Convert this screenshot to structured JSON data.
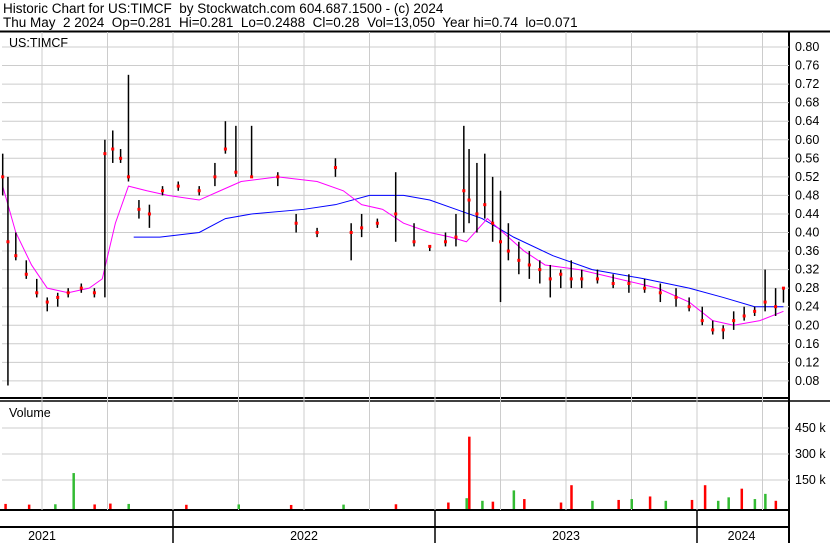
{
  "header": {
    "line1": "Historic Chart for US:TIMCF  by Stockwatch.com 604.687.1500 - (c) 2024",
    "line2": "Thu May  2 2024  Op=0.281  Hi=0.281  Lo=0.2488  Cl=0.28  Vol=13,050  Year hi=0.74  lo=0.071"
  },
  "chart_data": {
    "type": "line",
    "symbol": "US:TIMCF",
    "volume_label": "Volume",
    "price_ticks": [
      "0.80",
      "0.76",
      "0.72",
      "0.68",
      "0.64",
      "0.60",
      "0.56",
      "0.52",
      "0.48",
      "0.44",
      "0.40",
      "0.36",
      "0.32",
      "0.28",
      "0.24",
      "0.20",
      "0.16",
      "0.12",
      "0.08"
    ],
    "volume_ticks": [
      {
        "v": 450000,
        "label": "450 k"
      },
      {
        "v": 300000,
        "label": "300 k"
      },
      {
        "v": 150000,
        "label": "150 k"
      }
    ],
    "years": [
      {
        "label": "2021",
        "t": 2021.5
      },
      {
        "label": "2022",
        "t": 2022.5
      },
      {
        "label": "2023",
        "t": 2023.5
      },
      {
        "label": "2024",
        "t": 2024.17
      }
    ],
    "colors": {
      "price": "#000000",
      "close": "#ff0000",
      "ma_short": "#ff00ff",
      "ma_long": "#0000ff",
      "vol_up": "#33bb33",
      "vol_down": "#ff0000"
    },
    "ohlc": [
      [
        2021.35,
        0.57,
        0.48,
        0.52
      ],
      [
        2021.37,
        0.52,
        0.07,
        0.38
      ],
      [
        2021.4,
        0.4,
        0.34,
        0.35
      ],
      [
        2021.44,
        0.34,
        0.3,
        0.31
      ],
      [
        2021.48,
        0.3,
        0.26,
        0.27
      ],
      [
        2021.52,
        0.26,
        0.23,
        0.25
      ],
      [
        2021.56,
        0.27,
        0.24,
        0.26
      ],
      [
        2021.6,
        0.28,
        0.26,
        0.27
      ],
      [
        2021.65,
        0.29,
        0.27,
        0.28
      ],
      [
        2021.7,
        0.28,
        0.26,
        0.27
      ],
      [
        2021.74,
        0.6,
        0.26,
        0.57
      ],
      [
        2021.77,
        0.62,
        0.55,
        0.58
      ],
      [
        2021.8,
        0.58,
        0.55,
        0.56
      ],
      [
        2021.83,
        0.74,
        0.51,
        0.52
      ],
      [
        2021.87,
        0.47,
        0.43,
        0.45
      ],
      [
        2021.91,
        0.46,
        0.41,
        0.44
      ],
      [
        2021.96,
        0.5,
        0.48,
        0.49
      ],
      [
        2022.02,
        0.51,
        0.49,
        0.5
      ],
      [
        2022.1,
        0.5,
        0.48,
        0.49
      ],
      [
        2022.16,
        0.55,
        0.5,
        0.52
      ],
      [
        2022.2,
        0.64,
        0.57,
        0.58
      ],
      [
        2022.24,
        0.63,
        0.52,
        0.53
      ],
      [
        2022.3,
        0.63,
        0.52,
        0.52
      ],
      [
        2022.4,
        0.53,
        0.5,
        0.52
      ],
      [
        2022.47,
        0.44,
        0.4,
        0.42
      ],
      [
        2022.55,
        0.41,
        0.39,
        0.4
      ],
      [
        2022.62,
        0.56,
        0.52,
        0.54
      ],
      [
        2022.68,
        0.42,
        0.34,
        0.4
      ],
      [
        2022.72,
        0.44,
        0.39,
        0.41
      ],
      [
        2022.78,
        0.43,
        0.41,
        0.42
      ],
      [
        2022.85,
        0.53,
        0.38,
        0.44
      ],
      [
        2022.92,
        0.42,
        0.37,
        0.38
      ],
      [
        2022.98,
        0.37,
        0.36,
        0.37
      ],
      [
        2023.04,
        0.4,
        0.37,
        0.38
      ],
      [
        2023.08,
        0.44,
        0.37,
        0.39
      ],
      [
        2023.11,
        0.63,
        0.4,
        0.49
      ],
      [
        2023.13,
        0.58,
        0.42,
        0.47
      ],
      [
        2023.16,
        0.55,
        0.4,
        0.44
      ],
      [
        2023.19,
        0.57,
        0.43,
        0.46
      ],
      [
        2023.22,
        0.52,
        0.38,
        0.42
      ],
      [
        2023.25,
        0.49,
        0.25,
        0.38
      ],
      [
        2023.28,
        0.42,
        0.34,
        0.36
      ],
      [
        2023.32,
        0.38,
        0.31,
        0.34
      ],
      [
        2023.36,
        0.36,
        0.3,
        0.33
      ],
      [
        2023.4,
        0.34,
        0.29,
        0.32
      ],
      [
        2023.44,
        0.33,
        0.26,
        0.3
      ],
      [
        2023.48,
        0.32,
        0.28,
        0.31
      ],
      [
        2023.52,
        0.34,
        0.28,
        0.3
      ],
      [
        2023.56,
        0.32,
        0.28,
        0.3
      ],
      [
        2023.62,
        0.32,
        0.29,
        0.3
      ],
      [
        2023.68,
        0.31,
        0.28,
        0.29
      ],
      [
        2023.74,
        0.31,
        0.27,
        0.29
      ],
      [
        2023.8,
        0.3,
        0.27,
        0.28
      ],
      [
        2023.86,
        0.29,
        0.25,
        0.27
      ],
      [
        2023.92,
        0.28,
        0.24,
        0.26
      ],
      [
        2023.97,
        0.26,
        0.23,
        0.24
      ],
      [
        2024.02,
        0.24,
        0.2,
        0.21
      ],
      [
        2024.06,
        0.21,
        0.18,
        0.19
      ],
      [
        2024.1,
        0.2,
        0.17,
        0.19
      ],
      [
        2024.14,
        0.23,
        0.19,
        0.21
      ],
      [
        2024.18,
        0.24,
        0.21,
        0.22
      ],
      [
        2024.22,
        0.24,
        0.22,
        0.23
      ],
      [
        2024.26,
        0.32,
        0.23,
        0.25
      ],
      [
        2024.3,
        0.28,
        0.22,
        0.24
      ],
      [
        2024.33,
        0.281,
        0.2488,
        0.28
      ]
    ],
    "ma_short": [
      [
        2021.35,
        0.5
      ],
      [
        2021.4,
        0.4
      ],
      [
        2021.46,
        0.33
      ],
      [
        2021.52,
        0.28
      ],
      [
        2021.6,
        0.27
      ],
      [
        2021.68,
        0.28
      ],
      [
        2021.73,
        0.3
      ],
      [
        2021.78,
        0.42
      ],
      [
        2021.83,
        0.5
      ],
      [
        2021.9,
        0.49
      ],
      [
        2021.98,
        0.48
      ],
      [
        2022.1,
        0.47
      ],
      [
        2022.18,
        0.49
      ],
      [
        2022.26,
        0.51
      ],
      [
        2022.4,
        0.52
      ],
      [
        2022.55,
        0.51
      ],
      [
        2022.65,
        0.49
      ],
      [
        2022.72,
        0.46
      ],
      [
        2022.8,
        0.45
      ],
      [
        2022.88,
        0.42
      ],
      [
        2022.98,
        0.4
      ],
      [
        2023.06,
        0.39
      ],
      [
        2023.12,
        0.38
      ],
      [
        2023.2,
        0.43
      ],
      [
        2023.26,
        0.4
      ],
      [
        2023.34,
        0.36
      ],
      [
        2023.42,
        0.33
      ],
      [
        2023.55,
        0.32
      ],
      [
        2023.7,
        0.3
      ],
      [
        2023.85,
        0.28
      ],
      [
        2023.97,
        0.25
      ],
      [
        2024.06,
        0.21
      ],
      [
        2024.14,
        0.2
      ],
      [
        2024.24,
        0.21
      ],
      [
        2024.33,
        0.23
      ]
    ],
    "ma_long": [
      [
        2021.85,
        0.39
      ],
      [
        2021.95,
        0.39
      ],
      [
        2022.1,
        0.4
      ],
      [
        2022.2,
        0.43
      ],
      [
        2022.3,
        0.44
      ],
      [
        2022.5,
        0.45
      ],
      [
        2022.62,
        0.46
      ],
      [
        2022.75,
        0.48
      ],
      [
        2022.88,
        0.48
      ],
      [
        2022.98,
        0.47
      ],
      [
        2023.08,
        0.45
      ],
      [
        2023.18,
        0.43
      ],
      [
        2023.3,
        0.39
      ],
      [
        2023.45,
        0.35
      ],
      [
        2023.6,
        0.32
      ],
      [
        2023.8,
        0.3
      ],
      [
        2023.97,
        0.28
      ],
      [
        2024.1,
        0.26
      ],
      [
        2024.22,
        0.24
      ],
      [
        2024.33,
        0.24
      ]
    ],
    "volume": [
      [
        2021.36,
        12000,
        "r"
      ],
      [
        2021.45,
        8000,
        "r"
      ],
      [
        2021.55,
        10000,
        "g"
      ],
      [
        2021.62,
        190000,
        "g"
      ],
      [
        2021.7,
        9000,
        "r"
      ],
      [
        2021.76,
        14000,
        "r"
      ],
      [
        2021.83,
        12000,
        "g"
      ],
      [
        2022.05,
        7000,
        "r"
      ],
      [
        2022.25,
        9000,
        "g"
      ],
      [
        2022.45,
        6000,
        "r"
      ],
      [
        2022.65,
        8000,
        "g"
      ],
      [
        2022.85,
        10000,
        "r"
      ],
      [
        2023.05,
        20000,
        "r"
      ],
      [
        2023.12,
        45000,
        "g"
      ],
      [
        2023.13,
        400000,
        "r"
      ],
      [
        2023.18,
        30000,
        "g"
      ],
      [
        2023.22,
        25000,
        "r"
      ],
      [
        2023.3,
        90000,
        "g"
      ],
      [
        2023.34,
        40000,
        "r"
      ],
      [
        2023.48,
        20000,
        "r"
      ],
      [
        2023.52,
        120000,
        "r"
      ],
      [
        2023.6,
        30000,
        "g"
      ],
      [
        2023.7,
        35000,
        "r"
      ],
      [
        2023.75,
        40000,
        "g"
      ],
      [
        2023.82,
        55000,
        "r"
      ],
      [
        2023.88,
        30000,
        "g"
      ],
      [
        2023.98,
        35000,
        "r"
      ],
      [
        2024.03,
        120000,
        "r"
      ],
      [
        2024.08,
        30000,
        "g"
      ],
      [
        2024.12,
        50000,
        "g"
      ],
      [
        2024.17,
        100000,
        "r"
      ],
      [
        2024.22,
        40000,
        "g"
      ],
      [
        2024.26,
        70000,
        "g"
      ],
      [
        2024.3,
        30000,
        "r"
      ]
    ]
  }
}
